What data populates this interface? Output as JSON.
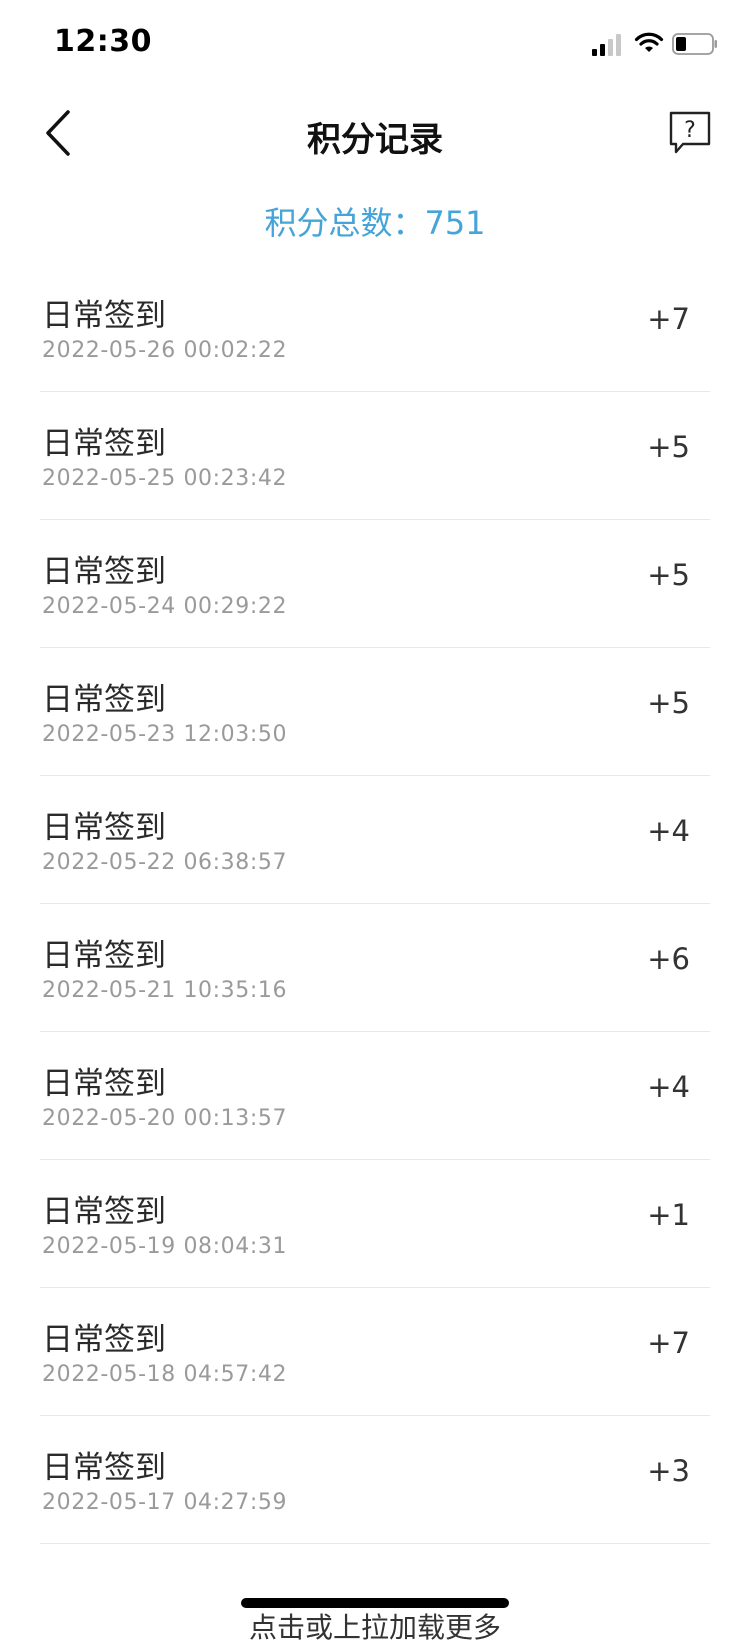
{
  "status_bar": {
    "time": "12:30"
  },
  "nav": {
    "title": "积分记录",
    "help_symbol": "?"
  },
  "summary": {
    "total_text": "积分总数：751"
  },
  "records": [
    {
      "title": "日常签到",
      "time": "2022-05-26 00:02:22",
      "points": "+7"
    },
    {
      "title": "日常签到",
      "time": "2022-05-25 00:23:42",
      "points": "+5"
    },
    {
      "title": "日常签到",
      "time": "2022-05-24 00:29:22",
      "points": "+5"
    },
    {
      "title": "日常签到",
      "time": "2022-05-23 12:03:50",
      "points": "+5"
    },
    {
      "title": "日常签到",
      "time": "2022-05-22 06:38:57",
      "points": "+4"
    },
    {
      "title": "日常签到",
      "time": "2022-05-21 10:35:16",
      "points": "+6"
    },
    {
      "title": "日常签到",
      "time": "2022-05-20 00:13:57",
      "points": "+4"
    },
    {
      "title": "日常签到",
      "time": "2022-05-19 08:04:31",
      "points": "+1"
    },
    {
      "title": "日常签到",
      "time": "2022-05-18 04:57:42",
      "points": "+7"
    },
    {
      "title": "日常签到",
      "time": "2022-05-17 04:27:59",
      "points": "+3"
    }
  ],
  "footer": {
    "load_more": "点击或上拉加载更多"
  },
  "colors": {
    "accent": "#45a4d8"
  },
  "icons": [
    "signal-icon",
    "wifi-icon",
    "battery-icon",
    "back-arrow-icon",
    "help-icon"
  ]
}
